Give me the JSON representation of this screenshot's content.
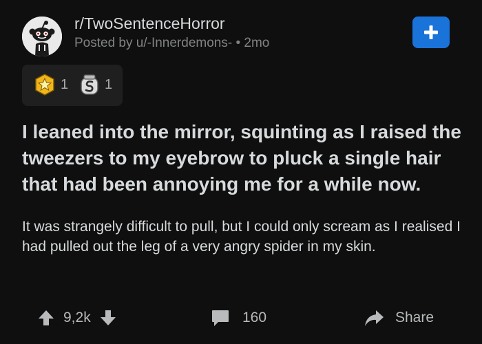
{
  "post": {
    "subreddit": "r/TwoSentenceHorror",
    "meta": "Posted by u/-Innerdemons- • 2mo",
    "title": "I leaned into the mirror, squinting as I raised the tweezers to my eyebrow to pluck a single hair that had been annoying me for a while now.",
    "body": "It was strangely difficult to pull, but I could only scream as I realised I had pulled out the leg of a very angry spider in my skin."
  },
  "awards": [
    {
      "icon": "gold-star-award-icon",
      "count": "1"
    },
    {
      "icon": "silver-award-icon",
      "count": "1"
    }
  ],
  "actions": {
    "vote_count": "9,2k",
    "comment_count": "160",
    "share_label": "Share"
  },
  "icons": {
    "join": "plus-icon",
    "upvote": "upvote-arrow-icon",
    "downvote": "downvote-arrow-icon",
    "comments": "comment-bubble-icon",
    "share": "share-arrow-icon",
    "avatar": "reddit-snoo-avatar"
  },
  "colors": {
    "background": "#0f0f0f",
    "text": "#d7dadc",
    "muted": "#818384",
    "join_button": "#1a73d9",
    "award_panel": "#1f1f1f"
  }
}
